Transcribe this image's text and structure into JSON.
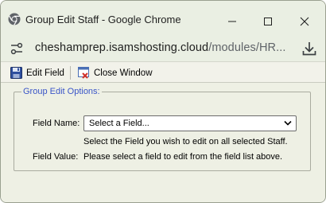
{
  "window": {
    "title": "Group Edit Staff - Google Chrome",
    "controls": {
      "minimize": "minimize",
      "maximize": "maximize",
      "close": "close"
    }
  },
  "address_bar": {
    "host": "cheshamprep.isamshosting.cloud",
    "path": "/modules/HR..."
  },
  "toolbar": {
    "edit_field_label": "Edit Field",
    "close_window_label": "Close Window"
  },
  "form": {
    "legend": "Group Edit Options:",
    "field_name_label": "Field Name:",
    "field_name_selected": "Select a Field...",
    "field_name_help": "Select the Field you wish to edit on all selected Staff.",
    "field_value_label": "Field Value:",
    "field_value_text": "Please select a field to edit from the field list above."
  },
  "icons": {
    "chrome": "chrome-icon",
    "site_info": "tune-icon",
    "download": "download-icon",
    "save": "floppy-disk-icon",
    "close_window": "window-close-icon"
  },
  "colors": {
    "chrome_frame": "#eaefe3",
    "legend_text": "#3a55c8",
    "toolbar_bg": "#f2f2ea"
  }
}
